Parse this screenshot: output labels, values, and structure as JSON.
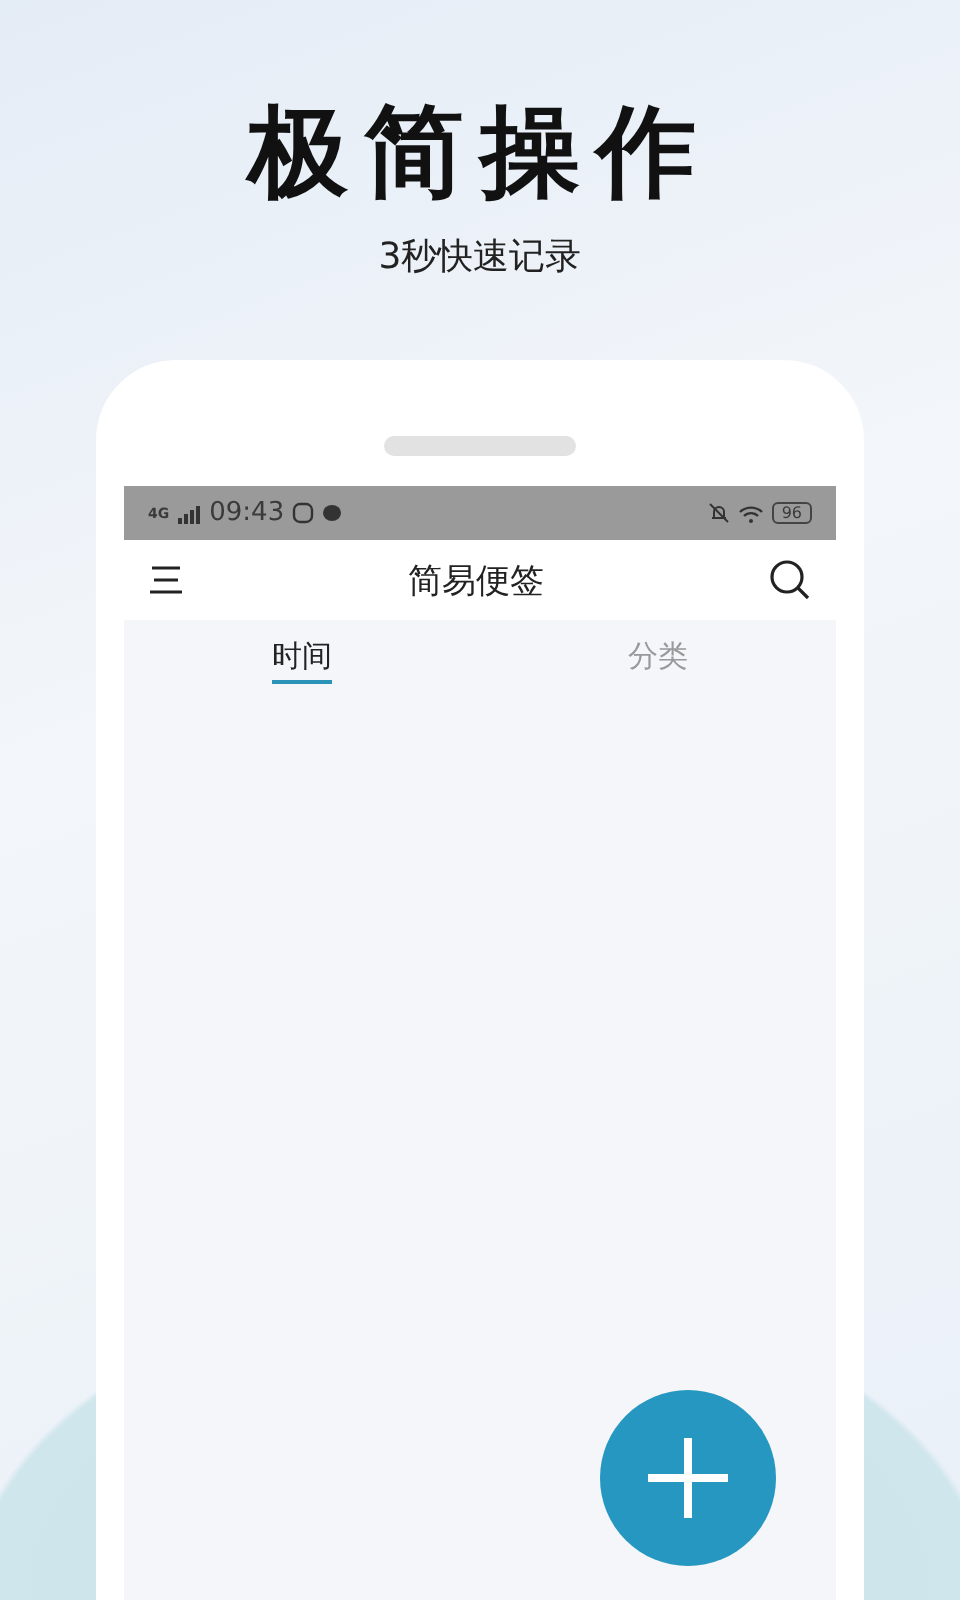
{
  "headline": "极简操作",
  "subtitle": "3秒快速记录",
  "status_bar": {
    "network": "4G",
    "time": "09:43",
    "battery": "96"
  },
  "app_bar": {
    "title": "简易便签"
  },
  "tabs": [
    {
      "label": "时间",
      "selected": true
    },
    {
      "label": "分类",
      "selected": false
    }
  ]
}
